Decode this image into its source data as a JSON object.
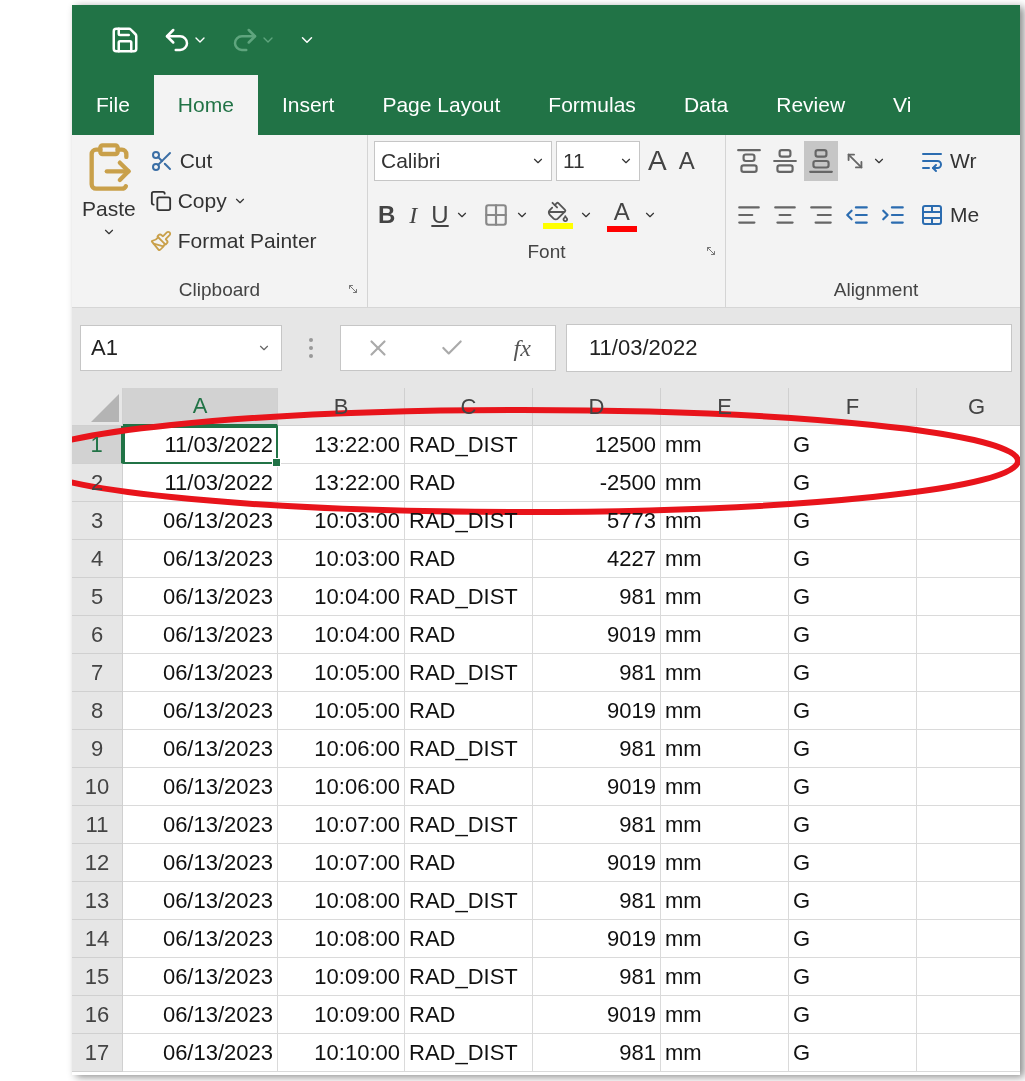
{
  "tabs": [
    {
      "label": "File",
      "selected": false
    },
    {
      "label": "Home",
      "selected": true
    },
    {
      "label": "Insert",
      "selected": false
    },
    {
      "label": "Page Layout",
      "selected": false
    },
    {
      "label": "Formulas",
      "selected": false
    },
    {
      "label": "Data",
      "selected": false
    },
    {
      "label": "Review",
      "selected": false
    },
    {
      "label": "Vi",
      "selected": false
    }
  ],
  "clipboard": {
    "paste": "Paste",
    "cut": "Cut",
    "copy": "Copy",
    "format_painter": "Format Painter",
    "group": "Clipboard"
  },
  "font": {
    "name": "Calibri",
    "size": "11",
    "grow": "A",
    "shrink": "A",
    "bold": "B",
    "italic": "I",
    "underline": "U",
    "color_letter": "A",
    "group": "Font"
  },
  "alignment": {
    "top_buttons": [
      {
        "kind": "top",
        "selected": false
      },
      {
        "kind": "middle",
        "selected": false
      },
      {
        "kind": "bottom",
        "selected": true
      }
    ],
    "wrap": "Wr",
    "merge": "Me",
    "group": "Alignment"
  },
  "formula_bar": {
    "name_box": "A1",
    "fx": "fx",
    "value": "11/03/2022"
  },
  "columns": [
    {
      "label": "A",
      "kind": "number",
      "selected": true
    },
    {
      "label": "B",
      "kind": "number",
      "selected": false
    },
    {
      "label": "C",
      "kind": "text",
      "selected": false
    },
    {
      "label": "D",
      "kind": "number",
      "selected": false
    },
    {
      "label": "E",
      "kind": "text",
      "selected": false
    },
    {
      "label": "F",
      "kind": "text",
      "selected": false
    },
    {
      "label": "G",
      "kind": "text",
      "selected": false
    }
  ],
  "rows": [
    {
      "number": "1",
      "selected": true,
      "cells": [
        "11/03/2022",
        "13:22:00",
        "RAD_DIST",
        "12500",
        "mm",
        "G"
      ]
    },
    {
      "number": "2",
      "selected": false,
      "cells": [
        "11/03/2022",
        "13:22:00",
        "RAD",
        "-2500",
        "mm",
        "G"
      ]
    },
    {
      "number": "3",
      "selected": false,
      "cells": [
        "06/13/2023",
        "10:03:00",
        "RAD_DIST",
        "5773",
        "mm",
        "G"
      ]
    },
    {
      "number": "4",
      "selected": false,
      "cells": [
        "06/13/2023",
        "10:03:00",
        "RAD",
        "4227",
        "mm",
        "G"
      ]
    },
    {
      "number": "5",
      "selected": false,
      "cells": [
        "06/13/2023",
        "10:04:00",
        "RAD_DIST",
        "981",
        "mm",
        "G"
      ]
    },
    {
      "number": "6",
      "selected": false,
      "cells": [
        "06/13/2023",
        "10:04:00",
        "RAD",
        "9019",
        "mm",
        "G"
      ]
    },
    {
      "number": "7",
      "selected": false,
      "cells": [
        "06/13/2023",
        "10:05:00",
        "RAD_DIST",
        "981",
        "mm",
        "G"
      ]
    },
    {
      "number": "8",
      "selected": false,
      "cells": [
        "06/13/2023",
        "10:05:00",
        "RAD",
        "9019",
        "mm",
        "G"
      ]
    },
    {
      "number": "9",
      "selected": false,
      "cells": [
        "06/13/2023",
        "10:06:00",
        "RAD_DIST",
        "981",
        "mm",
        "G"
      ]
    },
    {
      "number": "10",
      "selected": false,
      "cells": [
        "06/13/2023",
        "10:06:00",
        "RAD",
        "9019",
        "mm",
        "G"
      ]
    },
    {
      "number": "11",
      "selected": false,
      "cells": [
        "06/13/2023",
        "10:07:00",
        "RAD_DIST",
        "981",
        "mm",
        "G"
      ]
    },
    {
      "number": "12",
      "selected": false,
      "cells": [
        "06/13/2023",
        "10:07:00",
        "RAD",
        "9019",
        "mm",
        "G"
      ]
    },
    {
      "number": "13",
      "selected": false,
      "cells": [
        "06/13/2023",
        "10:08:00",
        "RAD_DIST",
        "981",
        "mm",
        "G"
      ]
    },
    {
      "number": "14",
      "selected": false,
      "cells": [
        "06/13/2023",
        "10:08:00",
        "RAD",
        "9019",
        "mm",
        "G"
      ]
    },
    {
      "number": "15",
      "selected": false,
      "cells": [
        "06/13/2023",
        "10:09:00",
        "RAD_DIST",
        "981",
        "mm",
        "G"
      ]
    },
    {
      "number": "16",
      "selected": false,
      "cells": [
        "06/13/2023",
        "10:09:00",
        "RAD",
        "9019",
        "mm",
        "G"
      ]
    },
    {
      "number": "17",
      "selected": false,
      "cells": [
        "06/13/2023",
        "10:10:00",
        "RAD_DIST",
        "981",
        "mm",
        "G"
      ]
    }
  ]
}
